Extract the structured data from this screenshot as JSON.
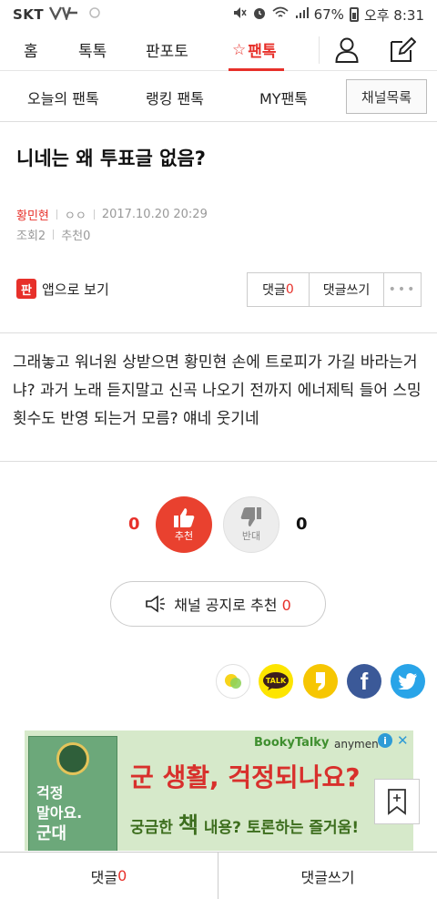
{
  "status_bar": {
    "carrier": "SKT",
    "battery": "67%",
    "time": "오후 8:31"
  },
  "top_nav": {
    "tabs": [
      {
        "label": "홈"
      },
      {
        "label": "톡톡"
      },
      {
        "label": "판포토"
      },
      {
        "label": "팬톡",
        "active": true,
        "icon": "star-icon"
      }
    ],
    "icons": [
      "user-icon",
      "edit-icon"
    ],
    "accent_color": "#e7302a"
  },
  "sub_nav": {
    "tabs": [
      {
        "label": "오늘의 팬톡"
      },
      {
        "label": "랭킹 팬톡"
      },
      {
        "label": "MY팬톡"
      }
    ],
    "channel_list_label": "채널목록"
  },
  "post": {
    "title": "니네는 왜 투표글 없음?",
    "author": "황민현",
    "author_tag": "ㅇㅇ",
    "date": "2017.10.20 20:29",
    "views": "조회2",
    "recommends": "추천0",
    "body": "그래놓고 워너원 상받으면 황민현 손에 트로피가 가길 바라는거냐? 과거 노래 듣지말고 신곡 나오기 전까지 에너제틱 들어 스밍횟수도 반영 되는거 모름? 얘네 웃기네"
  },
  "actions": {
    "app_logo_text": "판",
    "app_view_label": "앱으로 보기",
    "comment_label": "댓글",
    "comment_count": "0",
    "write_comment_label": "댓글쓰기",
    "more_label": "•••"
  },
  "votes": {
    "up_count": "0",
    "up_label": "추천",
    "down_count": "0",
    "down_label": "반대"
  },
  "notice": {
    "label": "채널 공지로 추천",
    "count": "0"
  },
  "share": {
    "buttons": [
      "kakaostory-icon",
      "kakaotalk-icon",
      "kakaopage-icon",
      "facebook-icon",
      "twitter-icon"
    ],
    "talk_text": "TALK",
    "fb_text": "f"
  },
  "ad": {
    "brand": "BookyTalky",
    "brand2": "anymen",
    "book_line1": "걱정",
    "book_line2": "말아요.",
    "book_line3": "군대",
    "headline": "군 생활, 걱정되나요?",
    "sub_part1": "궁금한",
    "sub_big": "책",
    "sub_part2": "내용? 토론하는 즐거움!"
  },
  "bottom_bar": {
    "comment_label": "댓글",
    "comment_count": "0",
    "write_label": "댓글쓰기"
  }
}
